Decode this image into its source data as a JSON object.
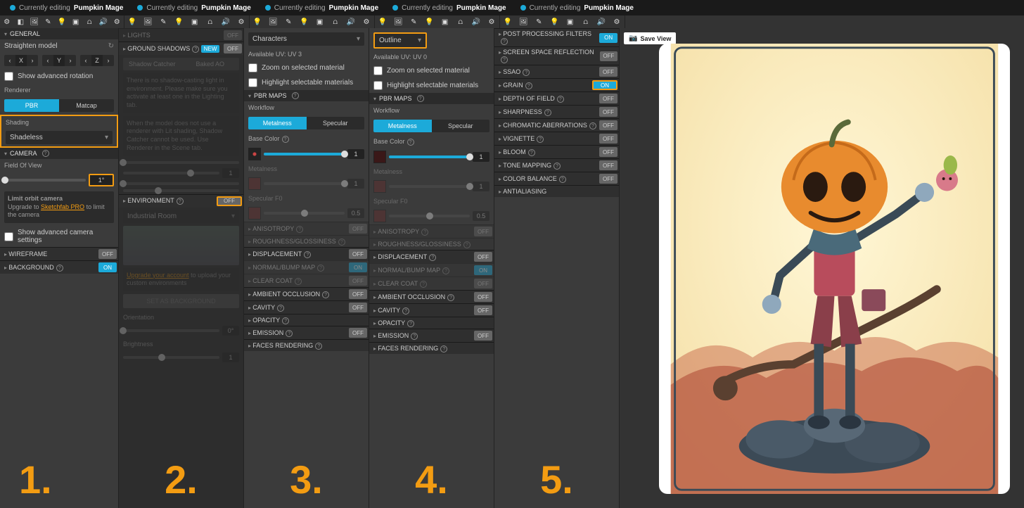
{
  "tabs": [
    {
      "editing": "Currently editing",
      "name": "Pumpkin Mage"
    },
    {
      "editing": "Currently editing",
      "name": "Pumpkin Mage"
    },
    {
      "editing": "Currently editing",
      "name": "Pumpkin Mage"
    },
    {
      "editing": "Currently editing",
      "name": "Pumpkin Mage"
    },
    {
      "editing": "Currently editing",
      "name": "Pumpkin Mage"
    }
  ],
  "p1": {
    "general": "General",
    "straighten": "Straighten model",
    "axes": [
      "X",
      "Y",
      "Z"
    ],
    "show_adv_rot": "Show advanced rotation",
    "renderer": "Renderer",
    "pbr": "PBR",
    "matcap": "Matcap",
    "shading": "Shading",
    "shadeless": "Shadeless",
    "camera": "Camera",
    "fov": "Field Of View",
    "fov_val": "1°",
    "limit_orbit": "Limit orbit camera",
    "limit_up": "Upgrade to ",
    "limit_pro": "Sketchfab PRO",
    "limit_tail": " to limit the camera",
    "show_adv_cam": "Show advanced camera settings",
    "wireframe": "Wireframe",
    "background": "Background",
    "num": "1."
  },
  "p2": {
    "lights": "Lights",
    "lights_off": "OFF",
    "gs": "Ground Shadows",
    "new": "NEW",
    "gs_off": "OFF",
    "shadow_catcher": "Shadow Catcher",
    "baked_ao": "Baked AO",
    "env": "Environment",
    "env_off": "OFF",
    "env_name": "Industrial Room",
    "upgrade": "Upgrade your account",
    "upgrade_tail": " to upload your custom environments",
    "set_bg": "Set as background",
    "orientation": "Orientation",
    "orientation_val": "0°",
    "brightness": "Brightness",
    "brightness_val": "1",
    "num": "2."
  },
  "mat": {
    "characters": "Characters",
    "outline": "Outline",
    "uv3": "Available UV: UV 3",
    "uv0": "Available UV: UV 0",
    "zoom": "Zoom on selected material",
    "hl": "Highlight selectable materials",
    "pbr": "PBR Maps",
    "workflow": "Workflow",
    "metal": "Metalness",
    "spec": "Specular",
    "base": "Base Color",
    "metalness": "Metalness",
    "specf0": "Specular F0",
    "one": "1",
    "zero5": "0.5",
    "rows": [
      {
        "l": "Anisotropy",
        "v": "OFF"
      },
      {
        "l": "Roughness/Glossiness",
        "v": ""
      },
      {
        "l": "Displacement",
        "v": "OFF"
      },
      {
        "l": "Normal/Bump Map",
        "v": "ON"
      },
      {
        "l": "Clear Coat",
        "v": "OFF"
      },
      {
        "l": "Ambient Occlusion",
        "v": "OFF"
      },
      {
        "l": "Cavity",
        "v": "OFF"
      },
      {
        "l": "Opacity",
        "v": ""
      },
      {
        "l": "Emission",
        "v": "OFF"
      },
      {
        "l": "Faces Rendering",
        "v": ""
      }
    ],
    "num3": "3.",
    "num4": "4."
  },
  "p5": {
    "ppf": "Post Processing Filters",
    "on": "ON",
    "rows": [
      {
        "l": "Screen Space Reflection",
        "v": "OFF"
      },
      {
        "l": "SSAO",
        "v": "OFF"
      },
      {
        "l": "Grain",
        "v": "ON",
        "hl": true
      },
      {
        "l": "Depth of Field",
        "v": "OFF"
      },
      {
        "l": "Sharpness",
        "v": "OFF"
      },
      {
        "l": "Chromatic Aberrations",
        "v": "OFF"
      },
      {
        "l": "Vignette",
        "v": "OFF"
      },
      {
        "l": "Bloom",
        "v": "OFF"
      },
      {
        "l": "Tone Mapping",
        "v": "OFF"
      },
      {
        "l": "Color Balance",
        "v": "OFF"
      }
    ],
    "aa": "Antialiasing",
    "num": "5."
  },
  "save_view": "Save View"
}
